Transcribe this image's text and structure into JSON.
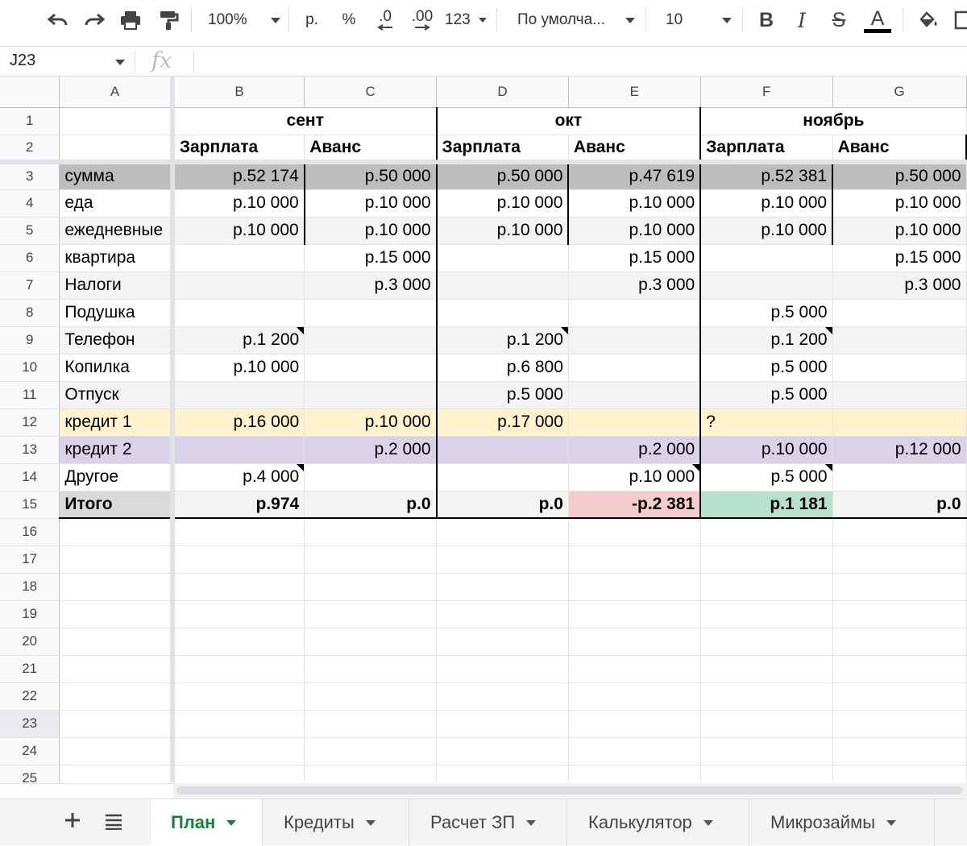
{
  "toolbar": {
    "zoom": "100%",
    "currency": "р.",
    "percent": "%",
    "decrease_decimals": ".0",
    "increase_decimals": ".00",
    "more_formats": "123",
    "font_family": "По умолча...",
    "font_size": "10",
    "bold": "B",
    "italic": "I",
    "strike": "S",
    "text_color": "A"
  },
  "formula_bar": {
    "name_box": "J23",
    "fx": "fx"
  },
  "column_headers": [
    "A",
    "B",
    "C",
    "D",
    "E",
    "F",
    "G"
  ],
  "row_numbers": [
    "1",
    "2",
    "3",
    "4",
    "5",
    "6",
    "7",
    "8",
    "9",
    "10",
    "11",
    "12",
    "13",
    "14",
    "15",
    "16",
    "17",
    "18",
    "19",
    "20",
    "21",
    "22",
    "23",
    "24",
    "25"
  ],
  "months": {
    "sep": "сент",
    "oct": "окт",
    "nov": "ноябрь"
  },
  "subheaders": [
    "Зарплата",
    "Аванс",
    "Зарплата",
    "Аванс",
    "Зарплата",
    "Аванс"
  ],
  "rows": [
    {
      "label": "сумма",
      "cells": [
        "р.52 174",
        "р.50 000",
        "р.50 000",
        "р.47 619",
        "р.52 381",
        "р.50 000"
      ]
    },
    {
      "label": "еда",
      "cells": [
        "р.10 000",
        "р.10 000",
        "р.10 000",
        "р.10 000",
        "р.10 000",
        "р.10 000"
      ]
    },
    {
      "label": "ежедневные",
      "cells": [
        "р.10 000",
        "р.10 000",
        "р.10 000",
        "р.10 000",
        "р.10 000",
        "р.10 000"
      ]
    },
    {
      "label": "квартира",
      "cells": [
        "",
        "р.15 000",
        "",
        "р.15 000",
        "",
        "р.15 000"
      ]
    },
    {
      "label": "Налоги",
      "cells": [
        "",
        "р.3 000",
        "",
        "р.3 000",
        "",
        "р.3 000"
      ]
    },
    {
      "label": "Подушка",
      "cells": [
        "",
        "",
        "",
        "",
        "р.5 000",
        ""
      ]
    },
    {
      "label": "Телефон",
      "cells": [
        "р.1 200",
        "",
        "р.1 200",
        "",
        "р.1 200",
        ""
      ]
    },
    {
      "label": "Копилка",
      "cells": [
        "р.10 000",
        "",
        "р.6 800",
        "",
        "р.5 000",
        ""
      ]
    },
    {
      "label": "Отпуск",
      "cells": [
        "",
        "",
        "р.5 000",
        "",
        "р.5 000",
        ""
      ]
    },
    {
      "label": "кредит 1",
      "cells": [
        "р.16 000",
        "р.10 000",
        "р.17 000",
        "",
        "?",
        ""
      ]
    },
    {
      "label": "кредит 2",
      "cells": [
        "",
        "р.2 000",
        "",
        "р.2 000",
        "р.10 000",
        "р.12 000"
      ]
    },
    {
      "label": "Другое",
      "cells": [
        "р.4 000",
        "",
        "",
        "р.10 000",
        "р.5 000",
        ""
      ]
    },
    {
      "label": "Итого",
      "cells": [
        "р.974",
        "р.0",
        "р.0",
        "-р.2 381",
        "р.1 181",
        "р.0"
      ]
    }
  ],
  "colors": {
    "sum_row": "#bdbdbd",
    "band_row": "#f3f3f3",
    "credit1_row": "#fff2cc",
    "credit2_row": "#d9d2e9",
    "total_label": "#d9d9d9",
    "total_row": "#f3f3f3",
    "negative_total": "#f4cccc",
    "positive_total": "#b7e1cd",
    "active_tab": "#188038"
  },
  "sheet_tabs": [
    "План",
    "Кредиты",
    "Расчет ЗП",
    "Калькулятор",
    "Микрозаймы"
  ]
}
